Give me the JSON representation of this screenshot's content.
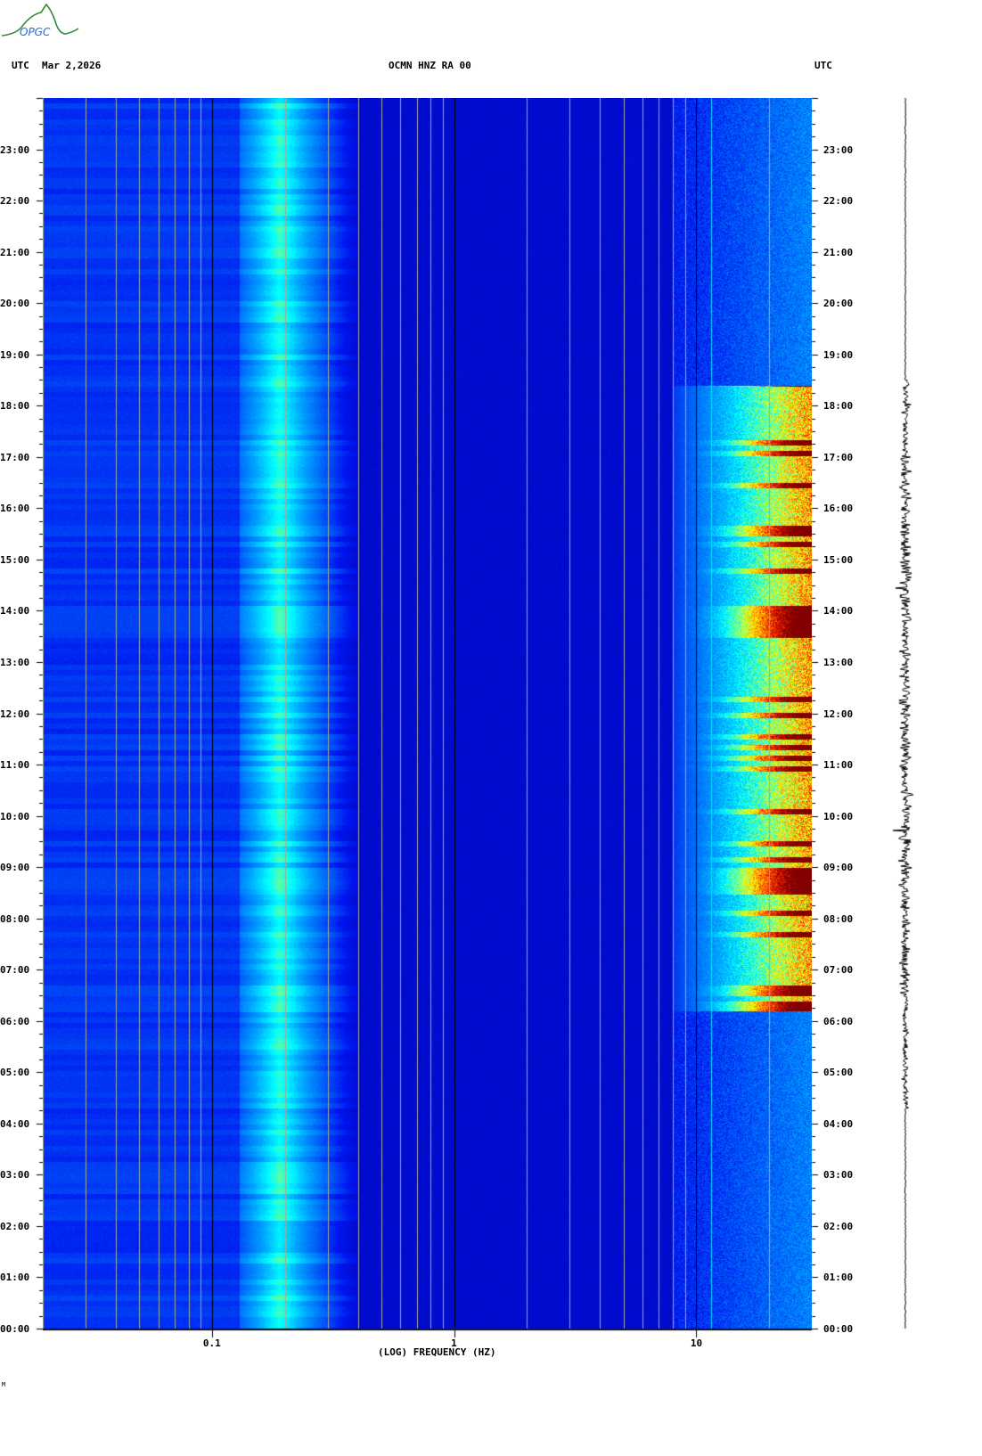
{
  "logo": {
    "text": "OPGC"
  },
  "header": {
    "left_tz": "UTC",
    "date": "Mar 2,2026",
    "station": "OCMN HNZ RA 00",
    "right_tz": "UTC"
  },
  "footer": {
    "mark": "M"
  },
  "chart_data": {
    "type": "heatmap",
    "title": "OCMN HNZ RA 00",
    "xlabel": "(LOG) FREQUENCY (HZ)",
    "ylabel": "UTC",
    "xscale": "log",
    "xlim": [
      0.02,
      30
    ],
    "ylim_hours": [
      0,
      24
    ],
    "x_ticks": [
      {
        "value": 0.1,
        "label": "0.1"
      },
      {
        "value": 1,
        "label": "1"
      },
      {
        "value": 10,
        "label": "10"
      }
    ],
    "y_ticks": [
      "00:00",
      "01:00",
      "02:00",
      "03:00",
      "04:00",
      "05:00",
      "06:00",
      "07:00",
      "08:00",
      "09:00",
      "10:00",
      "11:00",
      "12:00",
      "13:00",
      "14:00",
      "15:00",
      "16:00",
      "17:00",
      "18:00",
      "19:00",
      "20:00",
      "21:00",
      "22:00",
      "23:00"
    ],
    "features": {
      "microseism_band_hz": [
        0.15,
        0.3
      ],
      "high_freq_activity_hz": [
        8,
        30
      ],
      "high_freq_activity_hours": [
        6.2,
        18.4
      ]
    },
    "colors": {
      "low": "#0000a0",
      "mid": "#00ffff",
      "high": "#ff0000",
      "max": "#800000"
    }
  }
}
